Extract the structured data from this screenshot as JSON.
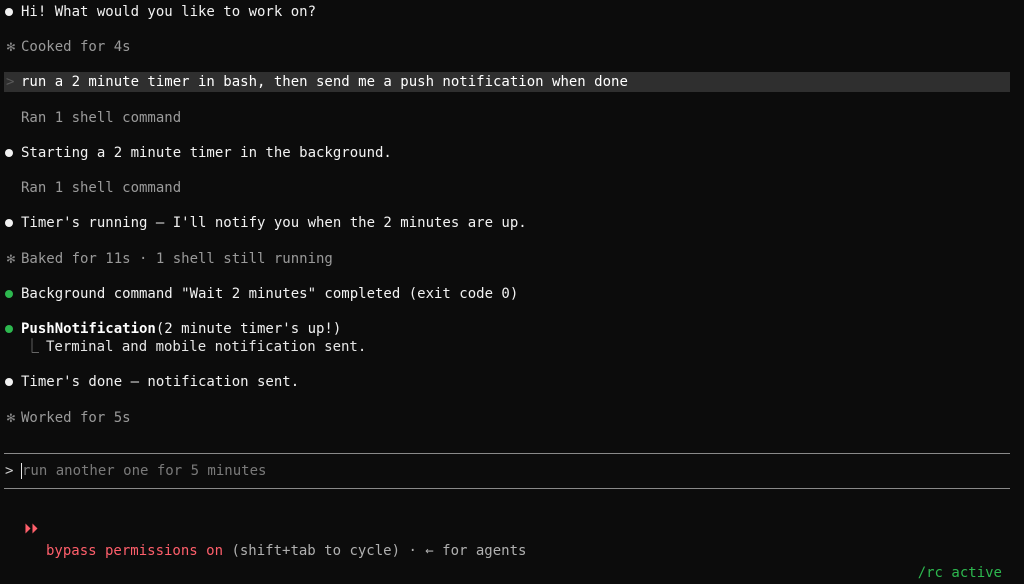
{
  "conversation": [
    {
      "kind": "assistant",
      "bullet": "white",
      "text": "Hi! What would you like to work on?"
    },
    {
      "kind": "status",
      "text": "Cooked for 4s"
    },
    {
      "kind": "user",
      "text": "run a 2 minute timer in bash, then send me a push notification when done"
    },
    {
      "kind": "tool",
      "text": "Ran 1 shell command"
    },
    {
      "kind": "assistant",
      "bullet": "white",
      "text": "Starting a 2 minute timer in the background."
    },
    {
      "kind": "tool",
      "text": "Ran 1 shell command"
    },
    {
      "kind": "assistant",
      "bullet": "white",
      "text": "Timer's running — I'll notify you when the 2 minutes are up."
    },
    {
      "kind": "status",
      "text": "Baked for 11s · 1 shell still running"
    },
    {
      "kind": "event",
      "bullet": "green",
      "text": "Background command \"Wait 2 minutes\" completed (exit code 0)"
    },
    {
      "kind": "tool_call",
      "bullet": "green",
      "name": "PushNotification",
      "args": "(2 minute timer's up!)",
      "result": "Terminal and mobile notification sent."
    },
    {
      "kind": "assistant",
      "bullet": "white",
      "text": "Timer's done — notification sent."
    },
    {
      "kind": "status",
      "text": "Worked for 5s"
    }
  ],
  "glyphs": {
    "status_star": "✻",
    "user_caret": ">",
    "tree_corner": "⎿",
    "prompt_caret": ">",
    "mode_arrows": "⏵⏵"
  },
  "prompt": {
    "value": "",
    "placeholder": "run another one for 5 minutes"
  },
  "statusbar": {
    "mode_label": "bypass permissions on",
    "mode_hint": " (shift+tab to cycle) · ← for agents",
    "rc_status": "/rc active"
  },
  "colors": {
    "background": "#0c0c0c",
    "accent_red": "#ff5f6b",
    "accent_green": "#2db84f",
    "user_highlight": "#2f2f2f"
  }
}
